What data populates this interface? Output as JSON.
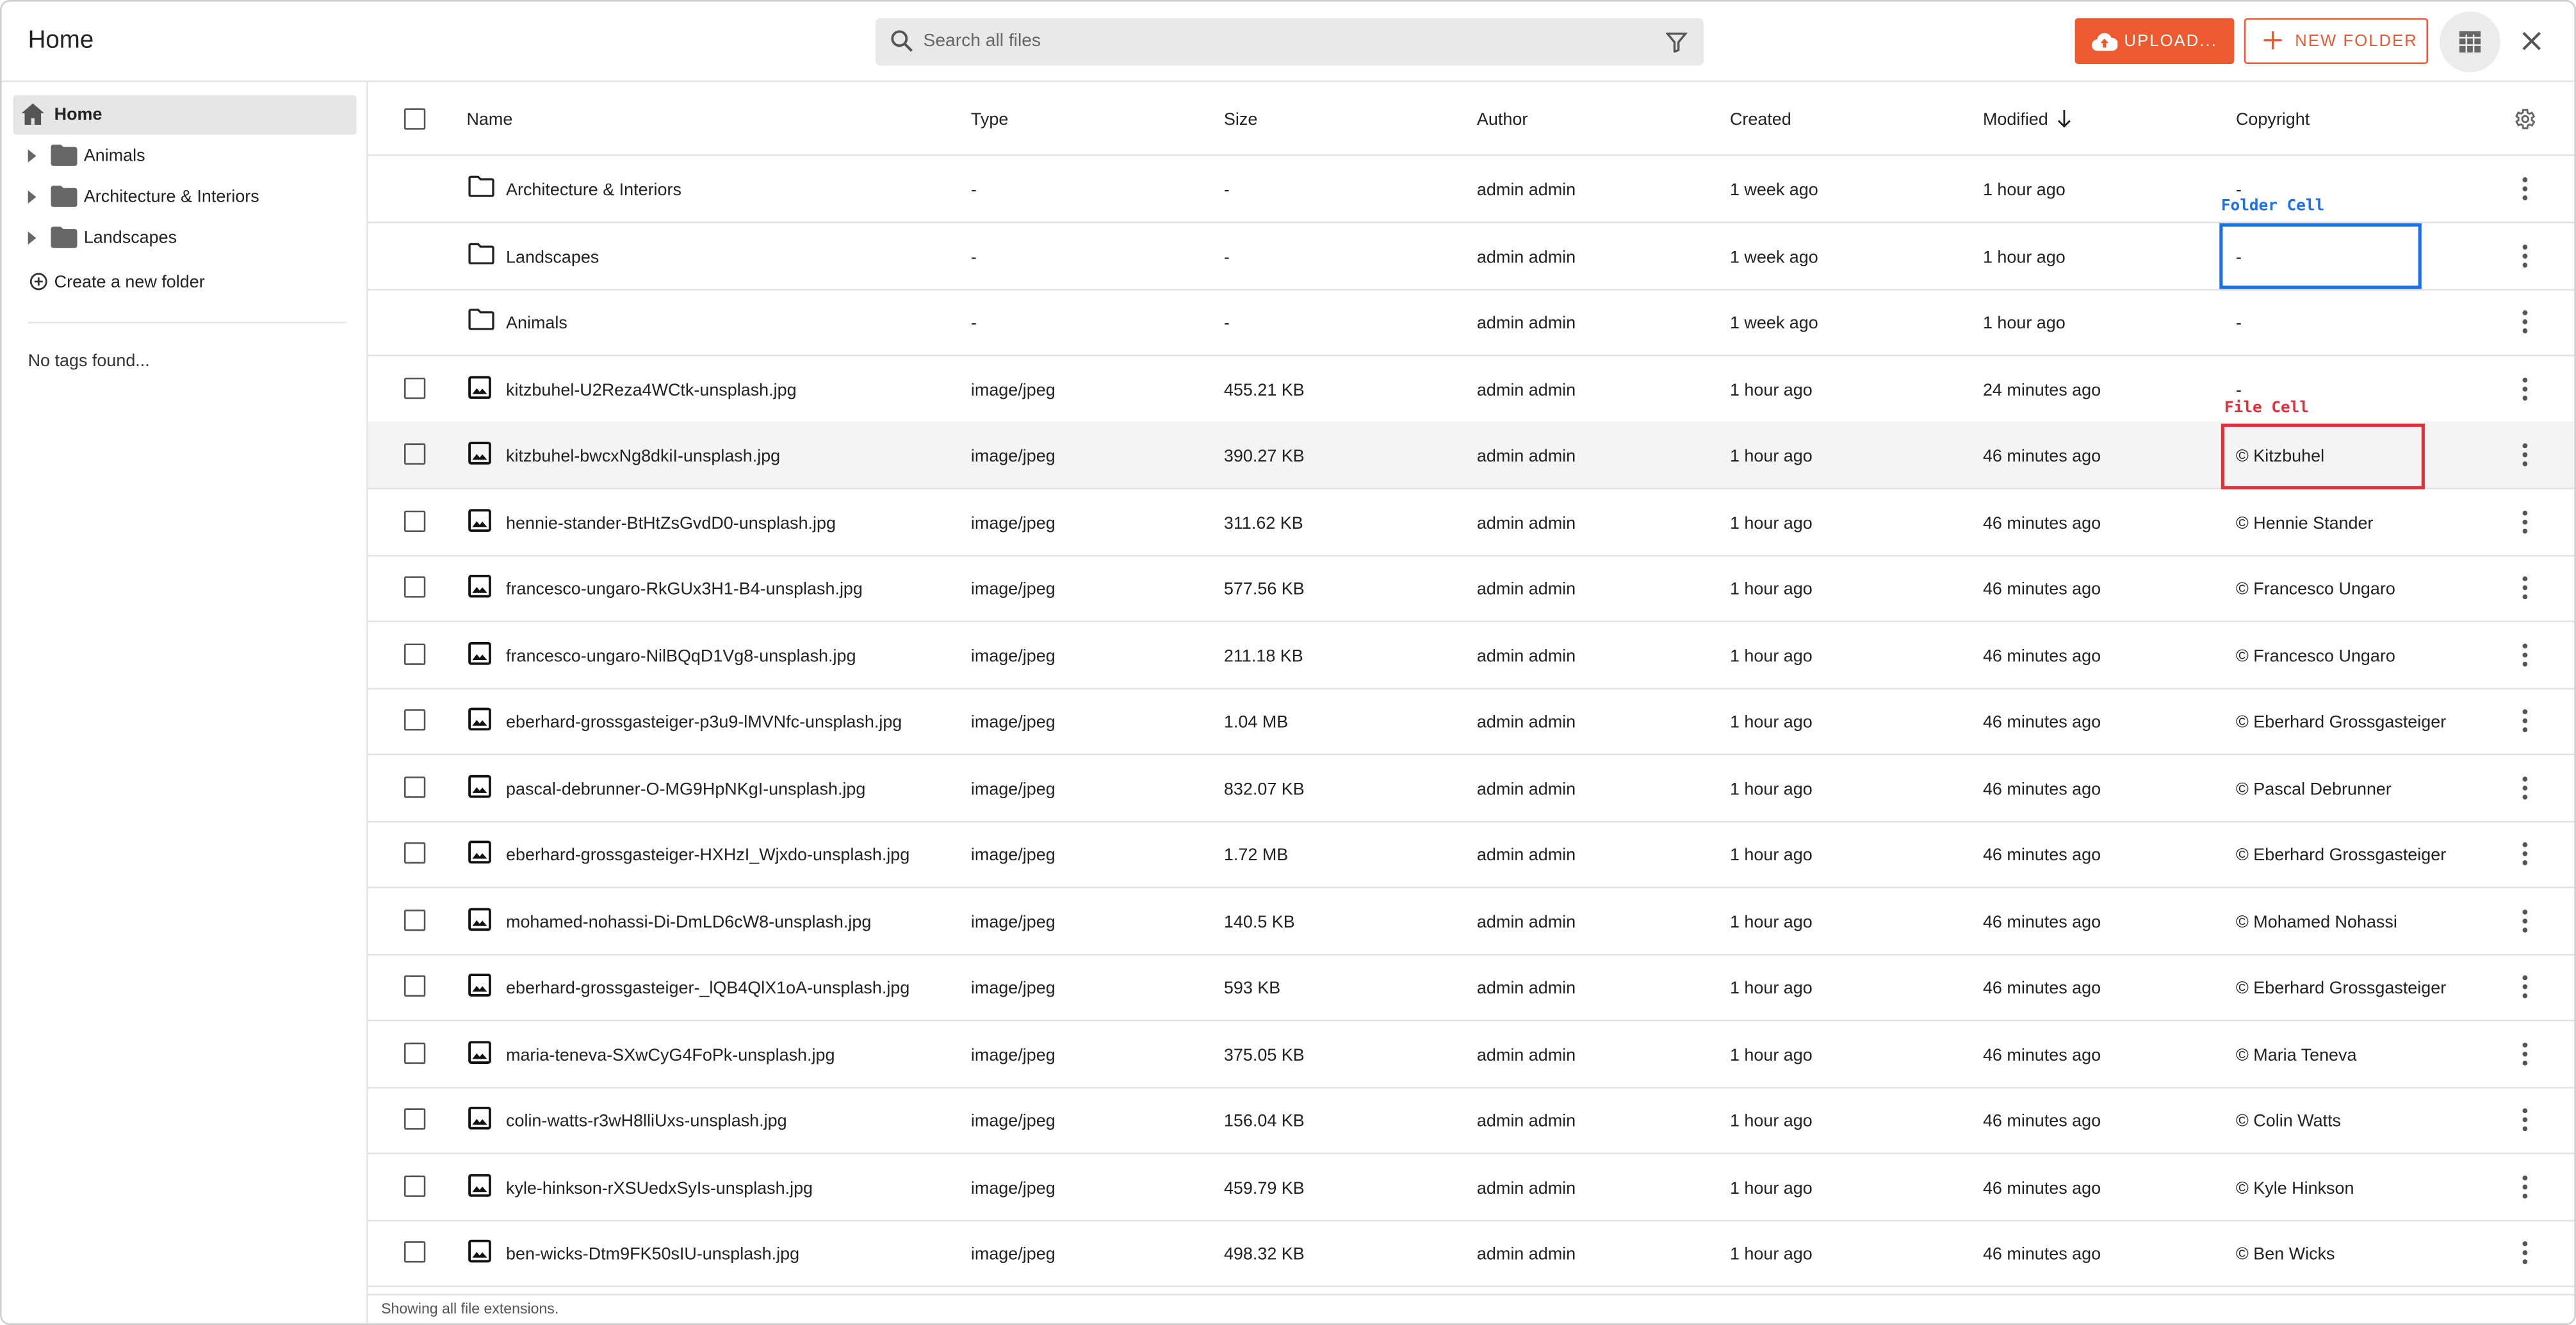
{
  "header": {
    "title": "Home",
    "search_placeholder": "Search all files",
    "upload_label": "UPLOAD...",
    "new_folder_label": "NEW FOLDER"
  },
  "sidebar": {
    "items": [
      {
        "label": "Home",
        "icon": "home-icon",
        "selected": true
      },
      {
        "label": "Animals",
        "icon": "folder-icon"
      },
      {
        "label": "Architecture & Interiors",
        "icon": "folder-icon"
      },
      {
        "label": "Landscapes",
        "icon": "folder-icon"
      }
    ],
    "create_label": "Create a new folder",
    "no_tags": "No tags found..."
  },
  "table": {
    "columns": [
      "Name",
      "Type",
      "Size",
      "Author",
      "Created",
      "Modified",
      "Copyright"
    ],
    "sort": {
      "column": "Modified",
      "direction": "desc"
    },
    "rows": [
      {
        "kind": "folder",
        "name": "Architecture & Interiors",
        "type": "-",
        "size": "-",
        "author": "admin admin",
        "created": "1 week ago",
        "modified": "1 hour ago",
        "copyright": "-"
      },
      {
        "kind": "folder",
        "name": "Landscapes",
        "type": "-",
        "size": "-",
        "author": "admin admin",
        "created": "1 week ago",
        "modified": "1 hour ago",
        "copyright": "-"
      },
      {
        "kind": "folder",
        "name": "Animals",
        "type": "-",
        "size": "-",
        "author": "admin admin",
        "created": "1 week ago",
        "modified": "1 hour ago",
        "copyright": "-"
      },
      {
        "kind": "file",
        "name": "kitzbuhel-U2Reza4WCtk-unsplash.jpg",
        "type": "image/jpeg",
        "size": "455.21 KB",
        "author": "admin admin",
        "created": "1 hour ago",
        "modified": "24 minutes ago",
        "copyright": "-"
      },
      {
        "kind": "file",
        "name": "kitzbuhel-bwcxNg8dkiI-unsplash.jpg",
        "type": "image/jpeg",
        "size": "390.27 KB",
        "author": "admin admin",
        "created": "1 hour ago",
        "modified": "46 minutes ago",
        "copyright": "© Kitzbuhel",
        "highlighted": true
      },
      {
        "kind": "file",
        "name": "hennie-stander-BtHtZsGvdD0-unsplash.jpg",
        "type": "image/jpeg",
        "size": "311.62 KB",
        "author": "admin admin",
        "created": "1 hour ago",
        "modified": "46 minutes ago",
        "copyright": "© Hennie Stander"
      },
      {
        "kind": "file",
        "name": "francesco-ungaro-RkGUx3H1-B4-unsplash.jpg",
        "type": "image/jpeg",
        "size": "577.56 KB",
        "author": "admin admin",
        "created": "1 hour ago",
        "modified": "46 minutes ago",
        "copyright": "© Francesco Ungaro"
      },
      {
        "kind": "file",
        "name": "francesco-ungaro-NilBQqD1Vg8-unsplash.jpg",
        "type": "image/jpeg",
        "size": "211.18 KB",
        "author": "admin admin",
        "created": "1 hour ago",
        "modified": "46 minutes ago",
        "copyright": "© Francesco Ungaro"
      },
      {
        "kind": "file",
        "name": "eberhard-grossgasteiger-p3u9-lMVNfc-unsplash.jpg",
        "type": "image/jpeg",
        "size": "1.04 MB",
        "author": "admin admin",
        "created": "1 hour ago",
        "modified": "46 minutes ago",
        "copyright": "© Eberhard Grossgasteiger"
      },
      {
        "kind": "file",
        "name": "pascal-debrunner-O-MG9HpNKgI-unsplash.jpg",
        "type": "image/jpeg",
        "size": "832.07 KB",
        "author": "admin admin",
        "created": "1 hour ago",
        "modified": "46 minutes ago",
        "copyright": "© Pascal Debrunner"
      },
      {
        "kind": "file",
        "name": "eberhard-grossgasteiger-HXHzI_Wjxdo-unsplash.jpg",
        "type": "image/jpeg",
        "size": "1.72 MB",
        "author": "admin admin",
        "created": "1 hour ago",
        "modified": "46 minutes ago",
        "copyright": "© Eberhard Grossgasteiger"
      },
      {
        "kind": "file",
        "name": "mohamed-nohassi-Di-DmLD6cW8-unsplash.jpg",
        "type": "image/jpeg",
        "size": "140.5 KB",
        "author": "admin admin",
        "created": "1 hour ago",
        "modified": "46 minutes ago",
        "copyright": "© Mohamed Nohassi"
      },
      {
        "kind": "file",
        "name": "eberhard-grossgasteiger-_lQB4QlX1oA-unsplash.jpg",
        "type": "image/jpeg",
        "size": "593 KB",
        "author": "admin admin",
        "created": "1 hour ago",
        "modified": "46 minutes ago",
        "copyright": "© Eberhard Grossgasteiger"
      },
      {
        "kind": "file",
        "name": "maria-teneva-SXwCyG4FoPk-unsplash.jpg",
        "type": "image/jpeg",
        "size": "375.05 KB",
        "author": "admin admin",
        "created": "1 hour ago",
        "modified": "46 minutes ago",
        "copyright": "© Maria Teneva"
      },
      {
        "kind": "file",
        "name": "colin-watts-r3wH8lliUxs-unsplash.jpg",
        "type": "image/jpeg",
        "size": "156.04 KB",
        "author": "admin admin",
        "created": "1 hour ago",
        "modified": "46 minutes ago",
        "copyright": "© Colin Watts"
      },
      {
        "kind": "file",
        "name": "kyle-hinkson-rXSUedxSyIs-unsplash.jpg",
        "type": "image/jpeg",
        "size": "459.79 KB",
        "author": "admin admin",
        "created": "1 hour ago",
        "modified": "46 minutes ago",
        "copyright": "© Kyle Hinkson"
      },
      {
        "kind": "file",
        "name": "ben-wicks-Dtm9FK50sIU-unsplash.jpg",
        "type": "image/jpeg",
        "size": "498.32 KB",
        "author": "admin admin",
        "created": "1 hour ago",
        "modified": "46 minutes ago",
        "copyright": "© Ben Wicks"
      }
    ]
  },
  "footer": "Showing all file extensions.",
  "annotations": [
    {
      "label": "Folder Cell",
      "color": "#1a6ef0"
    },
    {
      "label": "File Cell",
      "color": "#e0303a"
    }
  ],
  "colors": {
    "accent": "#ee5a30"
  }
}
